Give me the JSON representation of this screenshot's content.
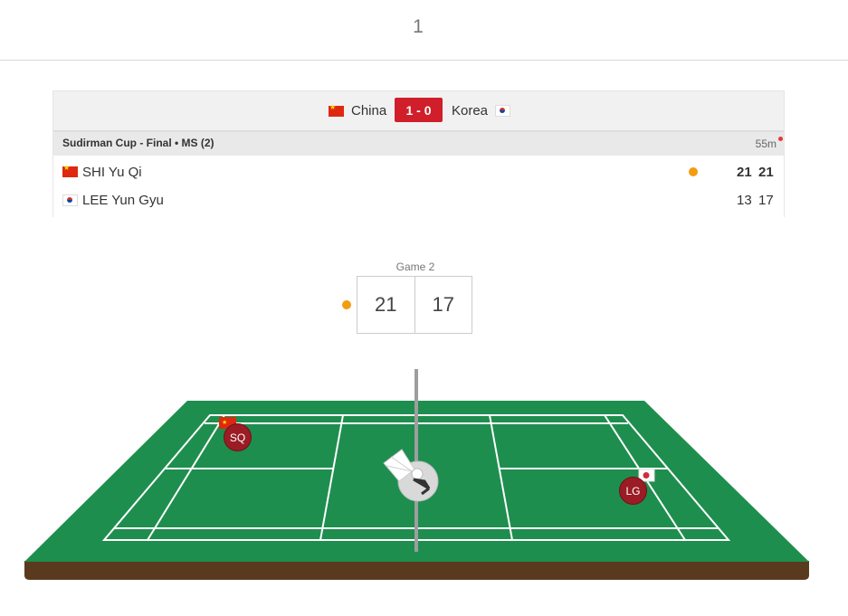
{
  "top": {
    "number": "1"
  },
  "match": {
    "team_left": "China",
    "team_right": "Korea",
    "team_score": "1 - 0",
    "event": "Sudirman Cup - Final • MS (2)",
    "duration": "55m",
    "players": [
      {
        "flag": "china-flag-icon",
        "name": "SHI Yu Qi",
        "g1": "21",
        "g2": "21",
        "serving": true
      },
      {
        "flag": "korea-flag-icon",
        "name": "LEE Yun Gyu",
        "g1": "13",
        "g2": "17",
        "serving": false
      }
    ]
  },
  "current_game": {
    "label": "Game 2",
    "score_left": "21",
    "score_right": "17"
  },
  "court": {
    "player_left": "SQ",
    "player_right": "LG",
    "shuttle_icon": "shuttlecock-icon",
    "colors": {
      "court": "#1e8e4e",
      "base": "#5a3a1e",
      "badge": "#9b1c24"
    }
  }
}
